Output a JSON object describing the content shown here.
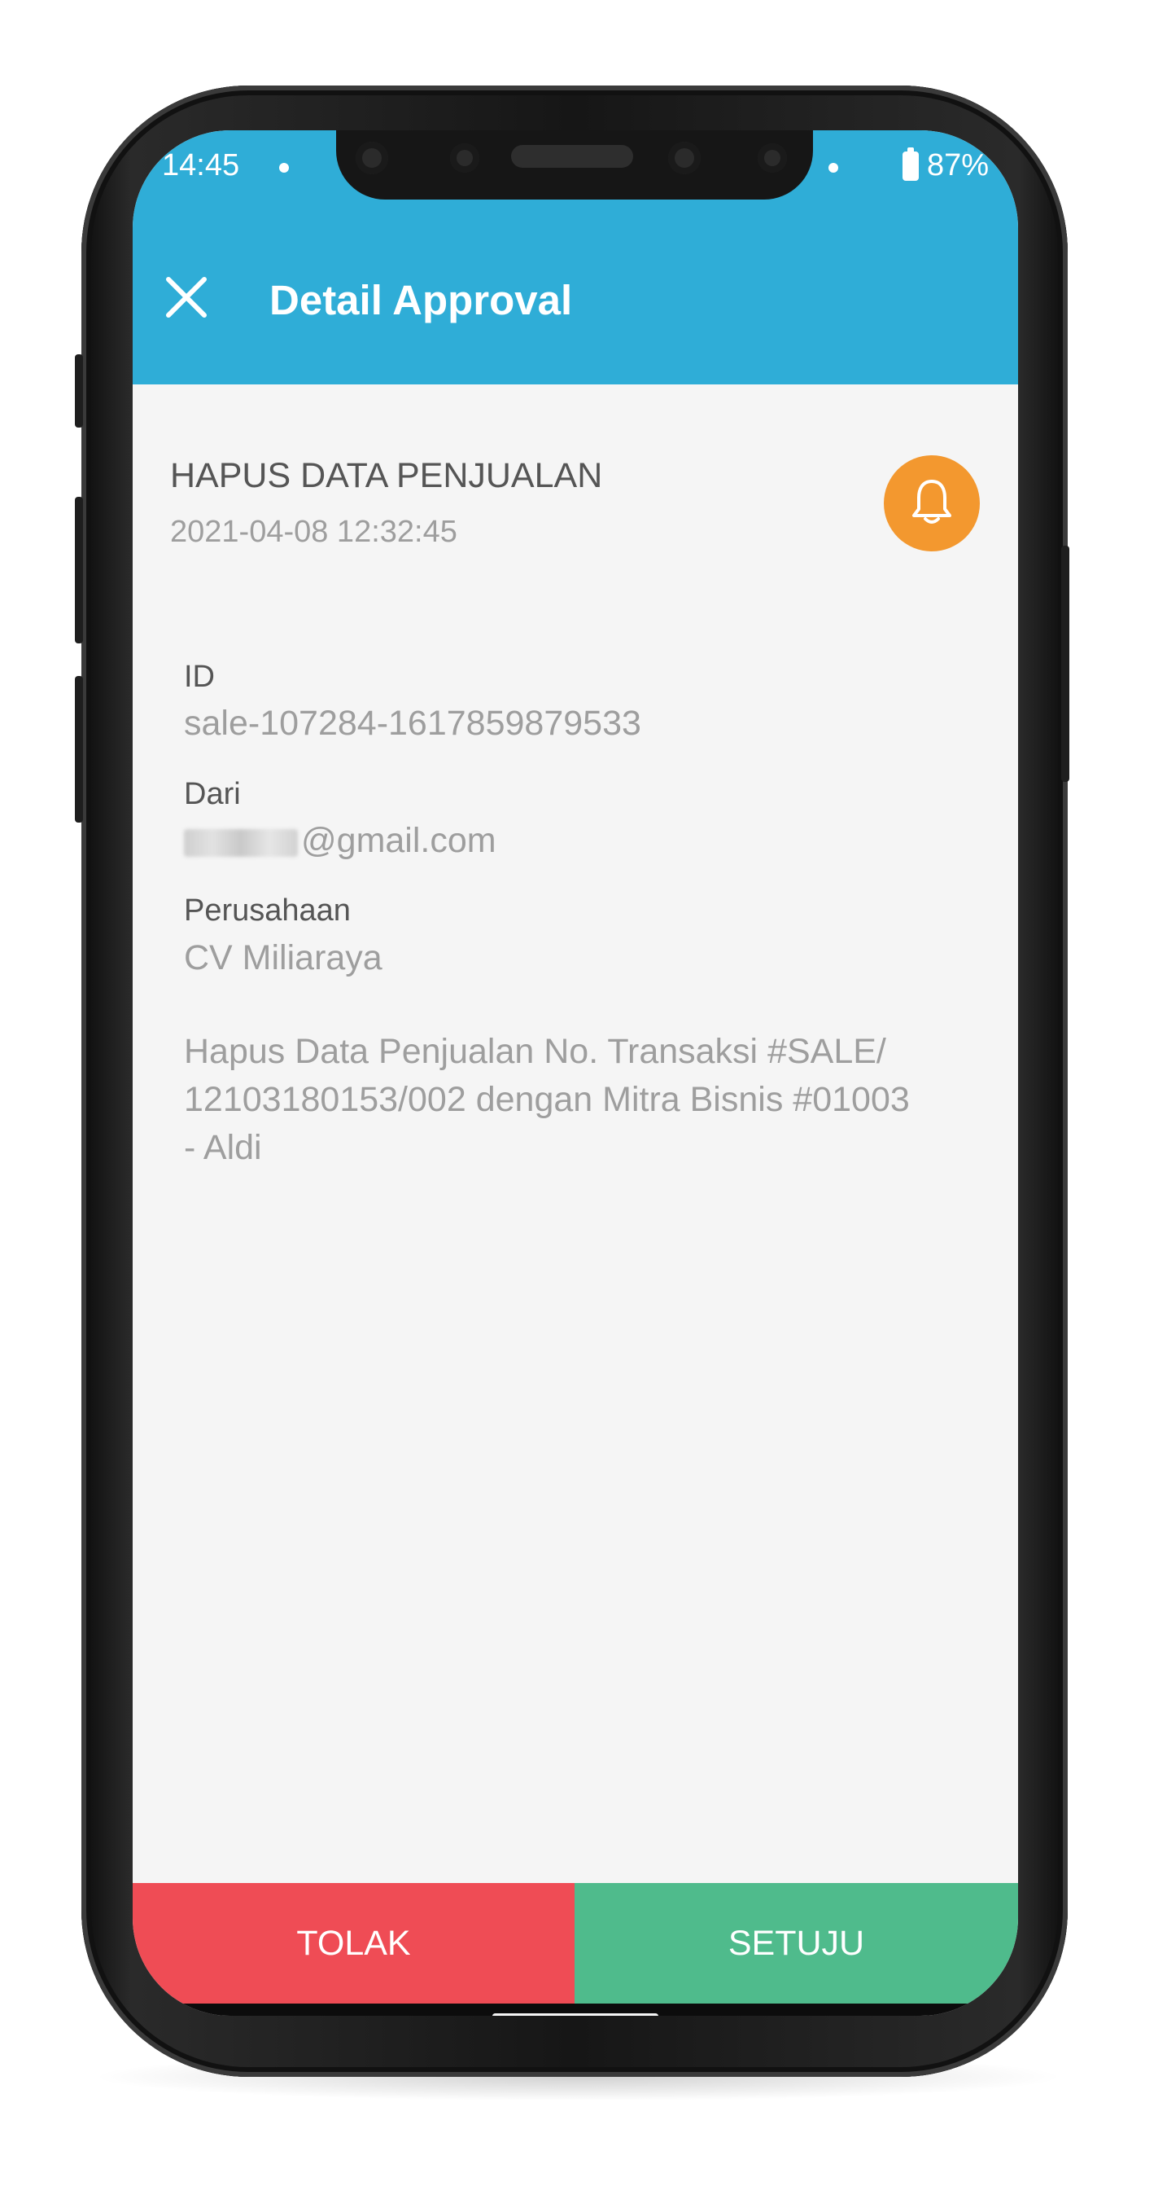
{
  "status_bar": {
    "time": "14:45",
    "battery": "87%"
  },
  "appbar": {
    "title": "Detail Approval",
    "close_icon": "close-icon"
  },
  "request": {
    "title": "HAPUS DATA PENJUALAN",
    "datetime": "2021-04-08 12:32:45",
    "bell_icon": "bell-icon",
    "bell_color": "#f3982f"
  },
  "fields": {
    "id_label": "ID",
    "id_value": "sale-107284-1617859879533",
    "from_label": "Dari",
    "from_value": "@gmail.com",
    "company_label": "Perusahaan",
    "company_value": "CV Miliaraya"
  },
  "description_lines": [
    "Hapus Data Penjualan No. Transaksi #SALE/",
    "12103180153/002 dengan Mitra Bisnis #01003",
    "- Aldi"
  ],
  "actions": {
    "reject_label": "TOLAK",
    "approve_label": "SETUJU",
    "reject_color": "#ef4c55",
    "approve_color": "#4fbb8c"
  },
  "colors": {
    "header": "#2fadd7",
    "background": "#f5f5f5"
  }
}
